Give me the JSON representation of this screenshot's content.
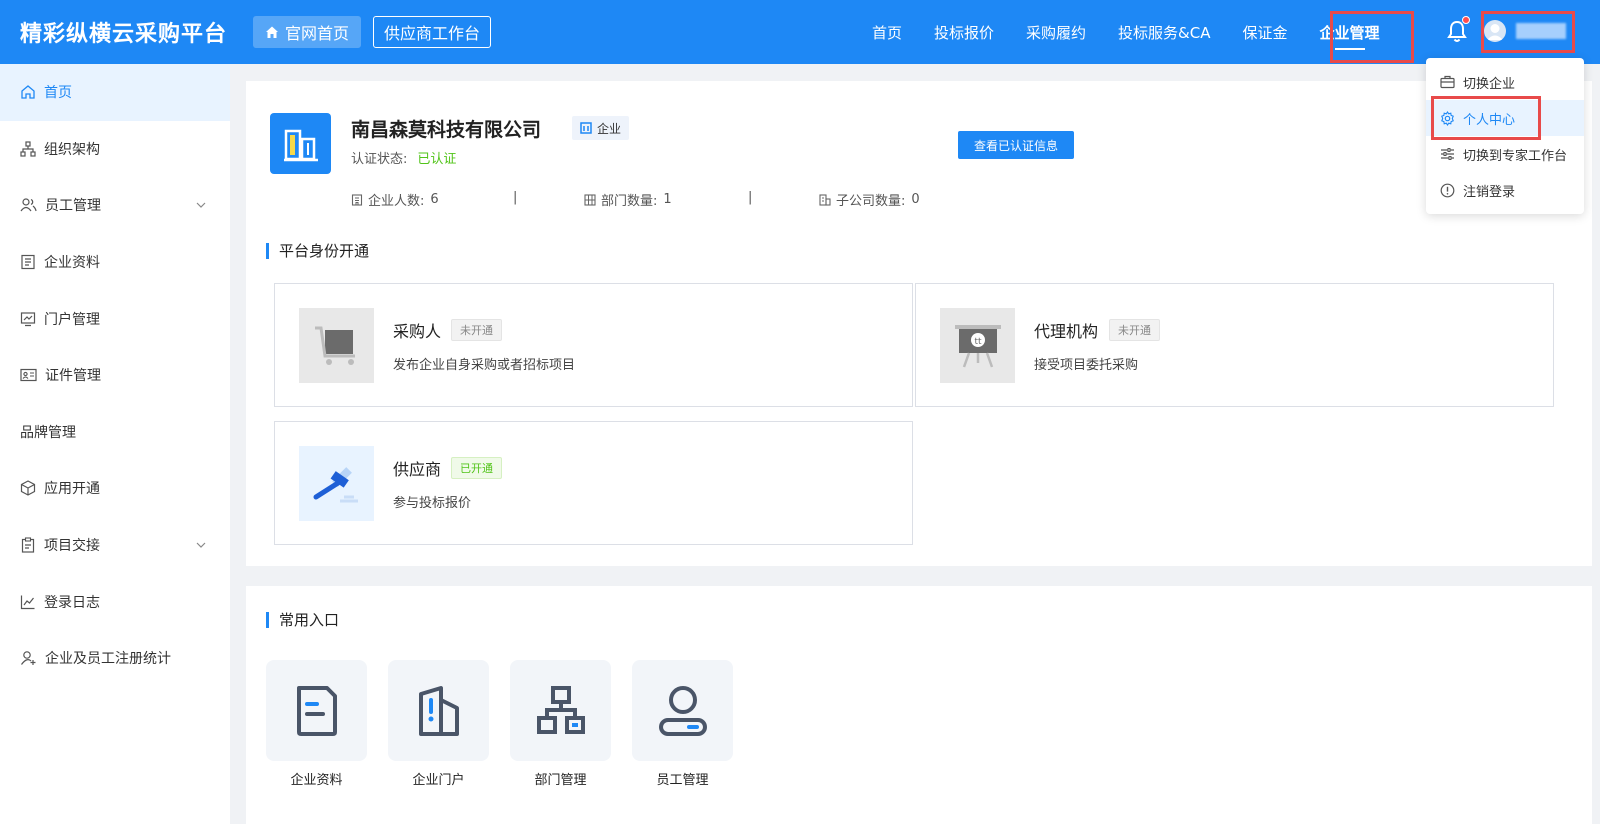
{
  "header": {
    "brand": "精彩纵横云采购平台",
    "home_label": "官网首页",
    "supplier_label": "供应商工作台",
    "nav": [
      "首页",
      "投标报价",
      "采购履约",
      "投标服务&CA",
      "保证金",
      "企业管理"
    ],
    "active_nav": "企业管理"
  },
  "dropdown": {
    "items": [
      "切换企业",
      "个人中心",
      "切换到专家工作台",
      "注销登录"
    ],
    "active": "个人中心"
  },
  "sidebar": {
    "items": [
      "首页",
      "组织架构",
      "员工管理",
      "企业资料",
      "门户管理",
      "证件管理",
      "品牌管理",
      "应用开通",
      "项目交接",
      "登录日志",
      "企业及员工注册统计"
    ],
    "active": "首页"
  },
  "company": {
    "name": "南昌森莫科技有限公司",
    "type": "企业",
    "status_label": "认证状态:",
    "status_value": "已认证",
    "view_button": "查看已认证信息",
    "stats": {
      "employees_label": "企业人数:",
      "employees_value": "6",
      "departments_label": "部门数量:",
      "departments_value": "1",
      "subsidiaries_label": "子公司数量:",
      "subsidiaries_value": "0",
      "separator": "|"
    }
  },
  "platform": {
    "title": "平台身份开通",
    "roles": [
      {
        "name": "采购人",
        "tag": "未开通",
        "desc": "发布企业自身采购或者招标项目"
      },
      {
        "name": "代理机构",
        "tag": "未开通",
        "desc": "接受项目委托采购"
      },
      {
        "name": "供应商",
        "tag": "已开通",
        "desc": "参与投标报价"
      }
    ]
  },
  "entries": {
    "title": "常用入口",
    "items": [
      "企业资料",
      "企业门户",
      "部门管理",
      "员工管理"
    ]
  },
  "colors": {
    "primary": "#1e88f5",
    "success": "#52c41a",
    "highlight": "#e84a4a"
  }
}
